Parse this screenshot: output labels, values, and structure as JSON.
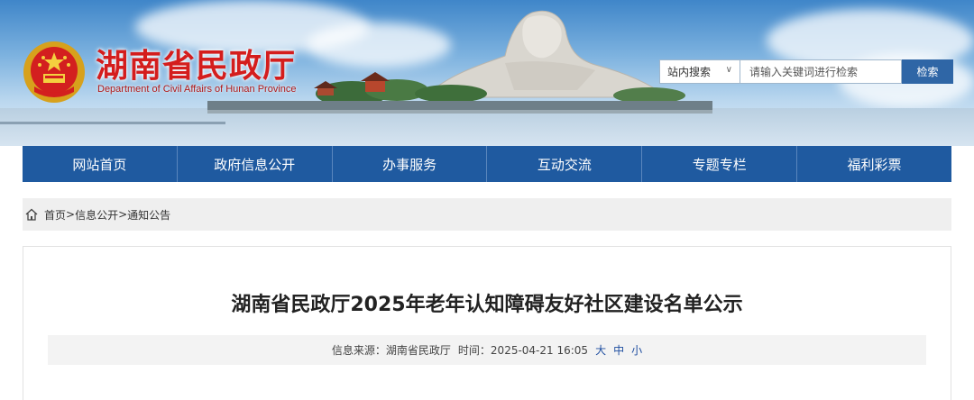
{
  "header": {
    "title": "湖南省民政厅",
    "subtitle": "Department of Civil Affairs of Hunan Province"
  },
  "search": {
    "scope": "站内搜索",
    "scope_arrow": "∨",
    "placeholder": "请输入关键词进行检索",
    "button": "检索"
  },
  "nav": {
    "items": [
      "网站首页",
      "政府信息公开",
      "办事服务",
      "互动交流",
      "专题专栏",
      "福利彩票"
    ]
  },
  "breadcrumb": {
    "items": [
      "首页",
      "信息公开",
      "通知公告"
    ],
    "separator": ">"
  },
  "article": {
    "title": "湖南省民政厅2025年老年认知障碍友好社区建设名单公示",
    "source_label": "信息来源：",
    "source": "湖南省民政厅",
    "time_label": "时间：",
    "time": "2025-04-21 16:05",
    "font_sizes": [
      "大",
      "中",
      "小"
    ]
  },
  "colors": {
    "nav_bg": "#1f5aa0",
    "title_red": "#d41d1d",
    "search_button": "#2f66a6"
  }
}
